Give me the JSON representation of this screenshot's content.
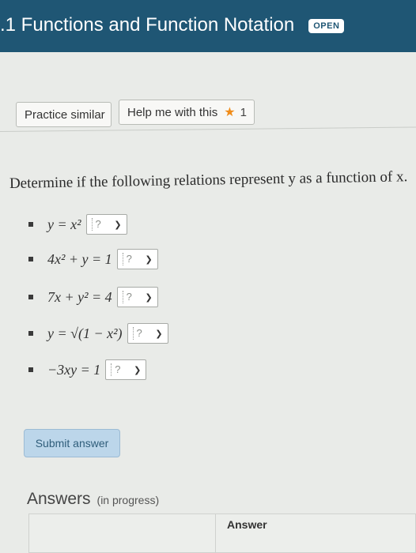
{
  "header": {
    "title": ".1 Functions and Function Notation",
    "badge": "OPEN",
    "bg_color": "#1f5674"
  },
  "buttons": {
    "practice_label": "Practice similar",
    "help_label": "Help me with this",
    "help_count": "1",
    "star_icon": "star-icon",
    "star_color": "#f08c1a"
  },
  "prompt": "Determine if the following relations represent y as a function of x.",
  "relations": [
    {
      "expr": "y = x²",
      "selected": "?"
    },
    {
      "expr": "4x² + y = 1",
      "selected": "?"
    },
    {
      "expr": "7x + y² = 4",
      "selected": "?"
    },
    {
      "expr": "y = √(1 − x²)",
      "selected": "?"
    },
    {
      "expr": "−3xy = 1",
      "selected": "?"
    }
  ],
  "submit_label": "Submit answer",
  "answers": {
    "title": "Answers",
    "status": "(in progress)",
    "column_header": "Answer"
  }
}
